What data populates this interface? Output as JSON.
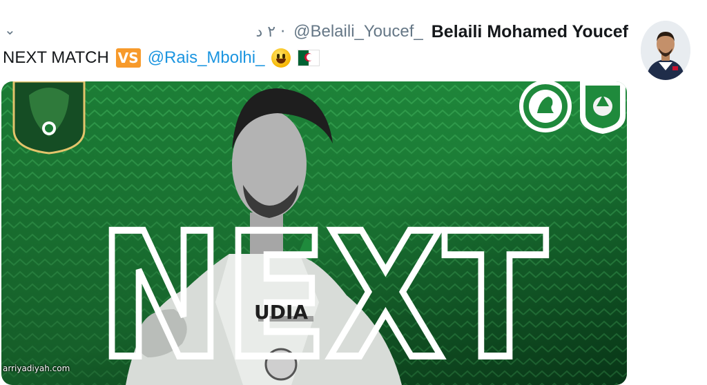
{
  "tweet": {
    "caret_icon": "chevron-down-icon",
    "timestamp": "٢ د",
    "separator": "·",
    "handle": "@Belaili_Youcef_",
    "display_name": "Belaili Mohamed Youcef",
    "text_prefix": "NEXT MATCH",
    "vs_emoji_label": "VS",
    "mention": "@Rais_Mbolhi_",
    "emojis": [
      "grinning-face-icon",
      "algeria-flag-icon"
    ]
  },
  "media": {
    "headline": "NEXT",
    "sponsor_text": "UDIA",
    "colors": {
      "green_dark": "#0b4a1f",
      "green": "#1f8a3c",
      "green_light": "#35a852",
      "white": "#ffffff"
    }
  },
  "watermark": "arriyadiyah.com",
  "colors": {
    "link": "#1b95e0",
    "muted": "#657786",
    "text": "#14171a",
    "vs_badge": "#f79a2b"
  }
}
